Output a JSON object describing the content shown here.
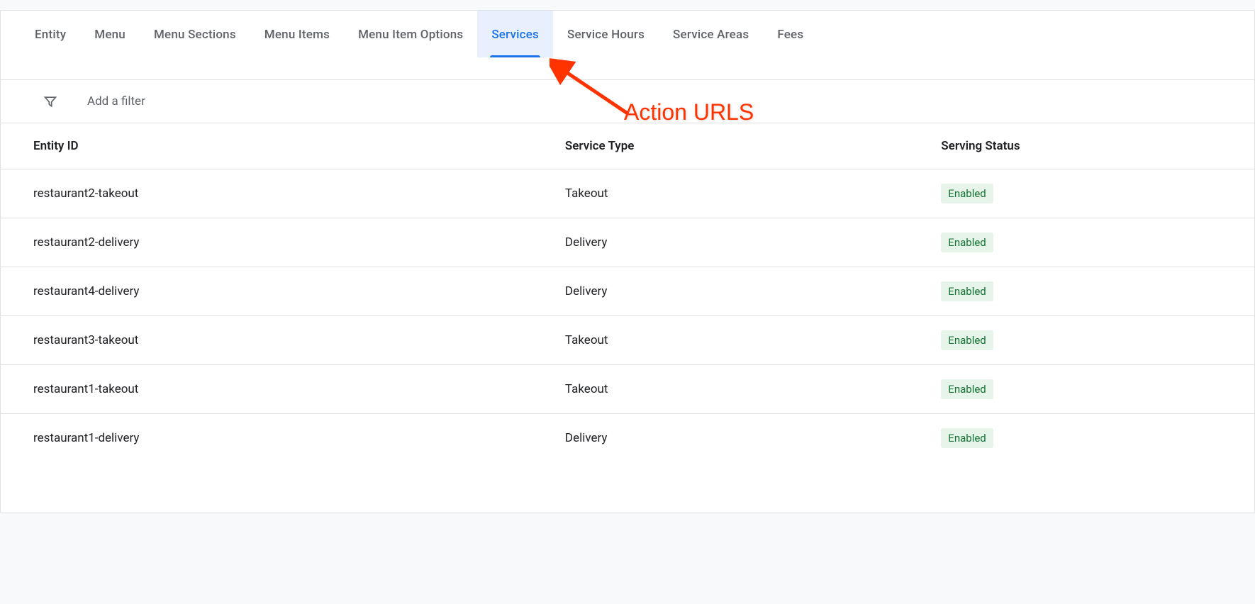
{
  "tabs": [
    {
      "label": "Entity",
      "active": false
    },
    {
      "label": "Menu",
      "active": false
    },
    {
      "label": "Menu Sections",
      "active": false
    },
    {
      "label": "Menu Items",
      "active": false
    },
    {
      "label": "Menu Item Options",
      "active": false
    },
    {
      "label": "Services",
      "active": true
    },
    {
      "label": "Service Hours",
      "active": false
    },
    {
      "label": "Service Areas",
      "active": false
    },
    {
      "label": "Fees",
      "active": false
    }
  ],
  "filter": {
    "placeholder": "Add a filter"
  },
  "table": {
    "headers": {
      "entity_id": "Entity ID",
      "service_type": "Service Type",
      "serving_status": "Serving Status"
    },
    "rows": [
      {
        "entity_id": "restaurant2-takeout",
        "service_type": "Takeout",
        "status": "Enabled"
      },
      {
        "entity_id": "restaurant2-delivery",
        "service_type": "Delivery",
        "status": "Enabled"
      },
      {
        "entity_id": "restaurant4-delivery",
        "service_type": "Delivery",
        "status": "Enabled"
      },
      {
        "entity_id": "restaurant3-takeout",
        "service_type": "Takeout",
        "status": "Enabled"
      },
      {
        "entity_id": "restaurant1-takeout",
        "service_type": "Takeout",
        "status": "Enabled"
      },
      {
        "entity_id": "restaurant1-delivery",
        "service_type": "Delivery",
        "status": "Enabled"
      }
    ]
  },
  "annotation": {
    "text": "Action URLS"
  }
}
